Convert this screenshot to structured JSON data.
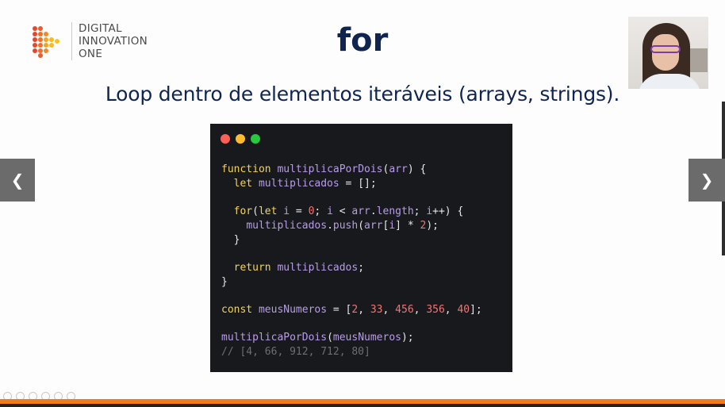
{
  "brand": {
    "line1": "DIGITAL",
    "line2": "INNOVATION",
    "line3": "ONE"
  },
  "slide": {
    "title": "for",
    "subtitle": "Loop dentro de elementos iteráveis (arrays, strings)."
  },
  "code": {
    "lines": [
      [
        {
          "t": "kw",
          "v": "function "
        },
        {
          "t": "fn",
          "v": "multiplicaPorDois"
        },
        {
          "t": "op",
          "v": "("
        },
        {
          "t": "var",
          "v": "arr"
        },
        {
          "t": "op",
          "v": ") {"
        }
      ],
      [
        {
          "t": "op",
          "v": "  "
        },
        {
          "t": "kw",
          "v": "let "
        },
        {
          "t": "var",
          "v": "multiplicados"
        },
        {
          "t": "op",
          "v": " = [];"
        }
      ],
      [
        {
          "t": "op",
          "v": ""
        }
      ],
      [
        {
          "t": "op",
          "v": "  "
        },
        {
          "t": "kw",
          "v": "for"
        },
        {
          "t": "op",
          "v": "("
        },
        {
          "t": "kw",
          "v": "let "
        },
        {
          "t": "var",
          "v": "i"
        },
        {
          "t": "op",
          "v": " = "
        },
        {
          "t": "num",
          "v": "0"
        },
        {
          "t": "op",
          "v": "; "
        },
        {
          "t": "var",
          "v": "i"
        },
        {
          "t": "op",
          "v": " < "
        },
        {
          "t": "var",
          "v": "arr"
        },
        {
          "t": "op",
          "v": "."
        },
        {
          "t": "var",
          "v": "length"
        },
        {
          "t": "op",
          "v": "; "
        },
        {
          "t": "var",
          "v": "i"
        },
        {
          "t": "op",
          "v": "++) {"
        }
      ],
      [
        {
          "t": "op",
          "v": "    "
        },
        {
          "t": "var",
          "v": "multiplicados"
        },
        {
          "t": "op",
          "v": "."
        },
        {
          "t": "var",
          "v": "push"
        },
        {
          "t": "op",
          "v": "("
        },
        {
          "t": "var",
          "v": "arr"
        },
        {
          "t": "op",
          "v": "["
        },
        {
          "t": "var",
          "v": "i"
        },
        {
          "t": "op",
          "v": "] * "
        },
        {
          "t": "num",
          "v": "2"
        },
        {
          "t": "op",
          "v": ");"
        }
      ],
      [
        {
          "t": "op",
          "v": "  }"
        }
      ],
      [
        {
          "t": "op",
          "v": ""
        }
      ],
      [
        {
          "t": "op",
          "v": "  "
        },
        {
          "t": "kw",
          "v": "return "
        },
        {
          "t": "var",
          "v": "multiplicados"
        },
        {
          "t": "op",
          "v": ";"
        }
      ],
      [
        {
          "t": "op",
          "v": "}"
        }
      ],
      [
        {
          "t": "op",
          "v": ""
        }
      ],
      [
        {
          "t": "kw",
          "v": "const "
        },
        {
          "t": "var",
          "v": "meusNumeros"
        },
        {
          "t": "op",
          "v": " = ["
        },
        {
          "t": "num",
          "v": "2"
        },
        {
          "t": "op",
          "v": ", "
        },
        {
          "t": "num",
          "v": "33"
        },
        {
          "t": "op",
          "v": ", "
        },
        {
          "t": "num",
          "v": "456"
        },
        {
          "t": "op",
          "v": ", "
        },
        {
          "t": "num",
          "v": "356"
        },
        {
          "t": "op",
          "v": ", "
        },
        {
          "t": "num",
          "v": "40"
        },
        {
          "t": "op",
          "v": "];"
        }
      ],
      [
        {
          "t": "op",
          "v": ""
        }
      ],
      [
        {
          "t": "fn",
          "v": "multiplicaPorDois"
        },
        {
          "t": "op",
          "v": "("
        },
        {
          "t": "var",
          "v": "meusNumeros"
        },
        {
          "t": "op",
          "v": ");"
        }
      ],
      [
        {
          "t": "cmt",
          "v": "// [4, 66, 912, 712, 80]"
        }
      ]
    ]
  },
  "nav": {
    "prev_icon": "chevron-left-icon",
    "next_icon": "chevron-right-icon",
    "prev_glyph": "❮",
    "next_glyph": "❯"
  },
  "colors": {
    "title": "#0f2550",
    "accent_bar": "#f07b1d",
    "code_bg": "#17191c"
  }
}
